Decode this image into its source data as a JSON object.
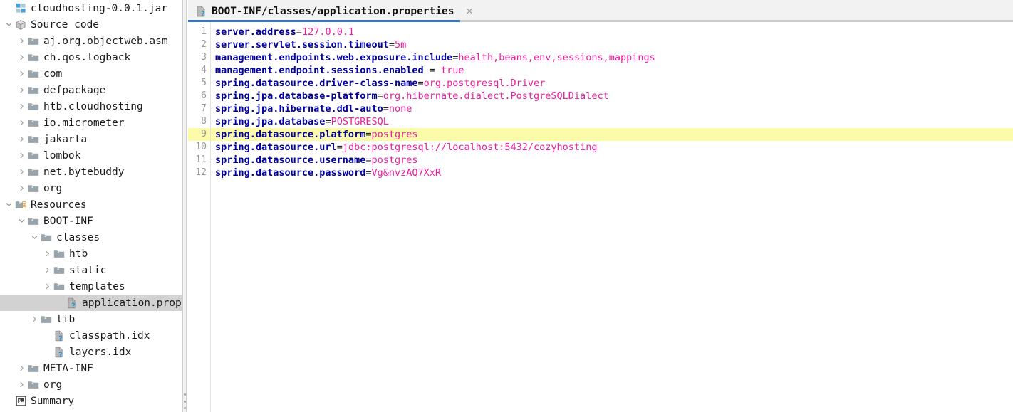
{
  "sidebar": {
    "tree": [
      {
        "label": "cloudhosting-0.0.1.jar",
        "indent": 0,
        "twisty": "none",
        "icon": "jar-icon",
        "selected": false
      },
      {
        "label": "Source code",
        "indent": 0,
        "twisty": "down",
        "icon": "module-cube-icon",
        "selected": false
      },
      {
        "label": "aj.org.objectweb.asm",
        "indent": 1,
        "twisty": "right",
        "icon": "package-folder-icon",
        "selected": false
      },
      {
        "label": "ch.qos.logback",
        "indent": 1,
        "twisty": "right",
        "icon": "package-folder-icon",
        "selected": false
      },
      {
        "label": "com",
        "indent": 1,
        "twisty": "right",
        "icon": "package-folder-icon",
        "selected": false
      },
      {
        "label": "defpackage",
        "indent": 1,
        "twisty": "right",
        "icon": "package-folder-icon",
        "selected": false
      },
      {
        "label": "htb.cloudhosting",
        "indent": 1,
        "twisty": "right",
        "icon": "package-folder-icon",
        "selected": false
      },
      {
        "label": "io.micrometer",
        "indent": 1,
        "twisty": "right",
        "icon": "package-folder-icon",
        "selected": false
      },
      {
        "label": "jakarta",
        "indent": 1,
        "twisty": "right",
        "icon": "package-folder-icon",
        "selected": false
      },
      {
        "label": "lombok",
        "indent": 1,
        "twisty": "right",
        "icon": "package-folder-icon",
        "selected": false
      },
      {
        "label": "net.bytebuddy",
        "indent": 1,
        "twisty": "right",
        "icon": "package-folder-icon",
        "selected": false
      },
      {
        "label": "org",
        "indent": 1,
        "twisty": "right",
        "icon": "package-folder-icon",
        "selected": false
      },
      {
        "label": "Resources",
        "indent": 0,
        "twisty": "down",
        "icon": "resource-folder-icon",
        "selected": false
      },
      {
        "label": "BOOT-INF",
        "indent": 1,
        "twisty": "down",
        "icon": "folder-icon",
        "selected": false
      },
      {
        "label": "classes",
        "indent": 2,
        "twisty": "down",
        "icon": "folder-icon",
        "selected": false
      },
      {
        "label": "htb",
        "indent": 3,
        "twisty": "right",
        "icon": "folder-icon",
        "selected": false
      },
      {
        "label": "static",
        "indent": 3,
        "twisty": "right",
        "icon": "folder-icon",
        "selected": false
      },
      {
        "label": "templates",
        "indent": 3,
        "twisty": "right",
        "icon": "folder-icon",
        "selected": false
      },
      {
        "label": "application.properties",
        "indent": 4,
        "twisty": "none",
        "icon": "unknown-file-icon",
        "selected": true
      },
      {
        "label": "lib",
        "indent": 2,
        "twisty": "right",
        "icon": "folder-icon",
        "selected": false
      },
      {
        "label": "classpath.idx",
        "indent": 3,
        "twisty": "none",
        "icon": "unknown-file-icon",
        "selected": false
      },
      {
        "label": "layers.idx",
        "indent": 3,
        "twisty": "none",
        "icon": "unknown-file-icon",
        "selected": false
      },
      {
        "label": "META-INF",
        "indent": 1,
        "twisty": "right",
        "icon": "folder-icon",
        "selected": false
      },
      {
        "label": "org",
        "indent": 1,
        "twisty": "right",
        "icon": "folder-icon",
        "selected": false
      },
      {
        "label": "Summary",
        "indent": 0,
        "twisty": "none",
        "icon": "summary-icon",
        "selected": false
      }
    ]
  },
  "editor": {
    "tab": {
      "title": "BOOT-INF/classes/application.properties",
      "icon": "unknown-file-icon",
      "close_label": "×",
      "active": true
    },
    "highlighted_line": 9,
    "lines": [
      {
        "num": "1",
        "key": "server.address",
        "sep": "=",
        "value": "127.0.0.1"
      },
      {
        "num": "2",
        "key": "server.servlet.session.timeout",
        "sep": "=",
        "value": "5m"
      },
      {
        "num": "3",
        "key": "management.endpoints.web.exposure.include",
        "sep": "=",
        "value": "health,beans,env,sessions,mappings"
      },
      {
        "num": "4",
        "key": "management.endpoint.sessions.enabled",
        "sep": " = ",
        "value": "true"
      },
      {
        "num": "5",
        "key": "spring.datasource.driver-class-name",
        "sep": "=",
        "value": "org.postgresql.Driver"
      },
      {
        "num": "6",
        "key": "spring.jpa.database-platform",
        "sep": "=",
        "value": "org.hibernate.dialect.PostgreSQLDialect"
      },
      {
        "num": "7",
        "key": "spring.jpa.hibernate.ddl-auto",
        "sep": "=",
        "value": "none"
      },
      {
        "num": "8",
        "key": "spring.jpa.database",
        "sep": "=",
        "value": "POSTGRESQL"
      },
      {
        "num": "9",
        "key": "spring.datasource.platform",
        "sep": "=",
        "value": "postgres"
      },
      {
        "num": "10",
        "key": "spring.datasource.url",
        "sep": "=",
        "value": "jdbc:postgresql://localhost:5432/cozyhosting"
      },
      {
        "num": "11",
        "key": "spring.datasource.username",
        "sep": "=",
        "value": "postgres"
      },
      {
        "num": "12",
        "key": "spring.datasource.password",
        "sep": "=",
        "value": "Vg&nvzAQ7XxR"
      }
    ]
  },
  "colors": {
    "key": "#00009f",
    "value": "#ee1ca0",
    "highlight": "#fcfbaa",
    "selection": "#d2d2d2",
    "tab_accent": "#3574c8"
  }
}
